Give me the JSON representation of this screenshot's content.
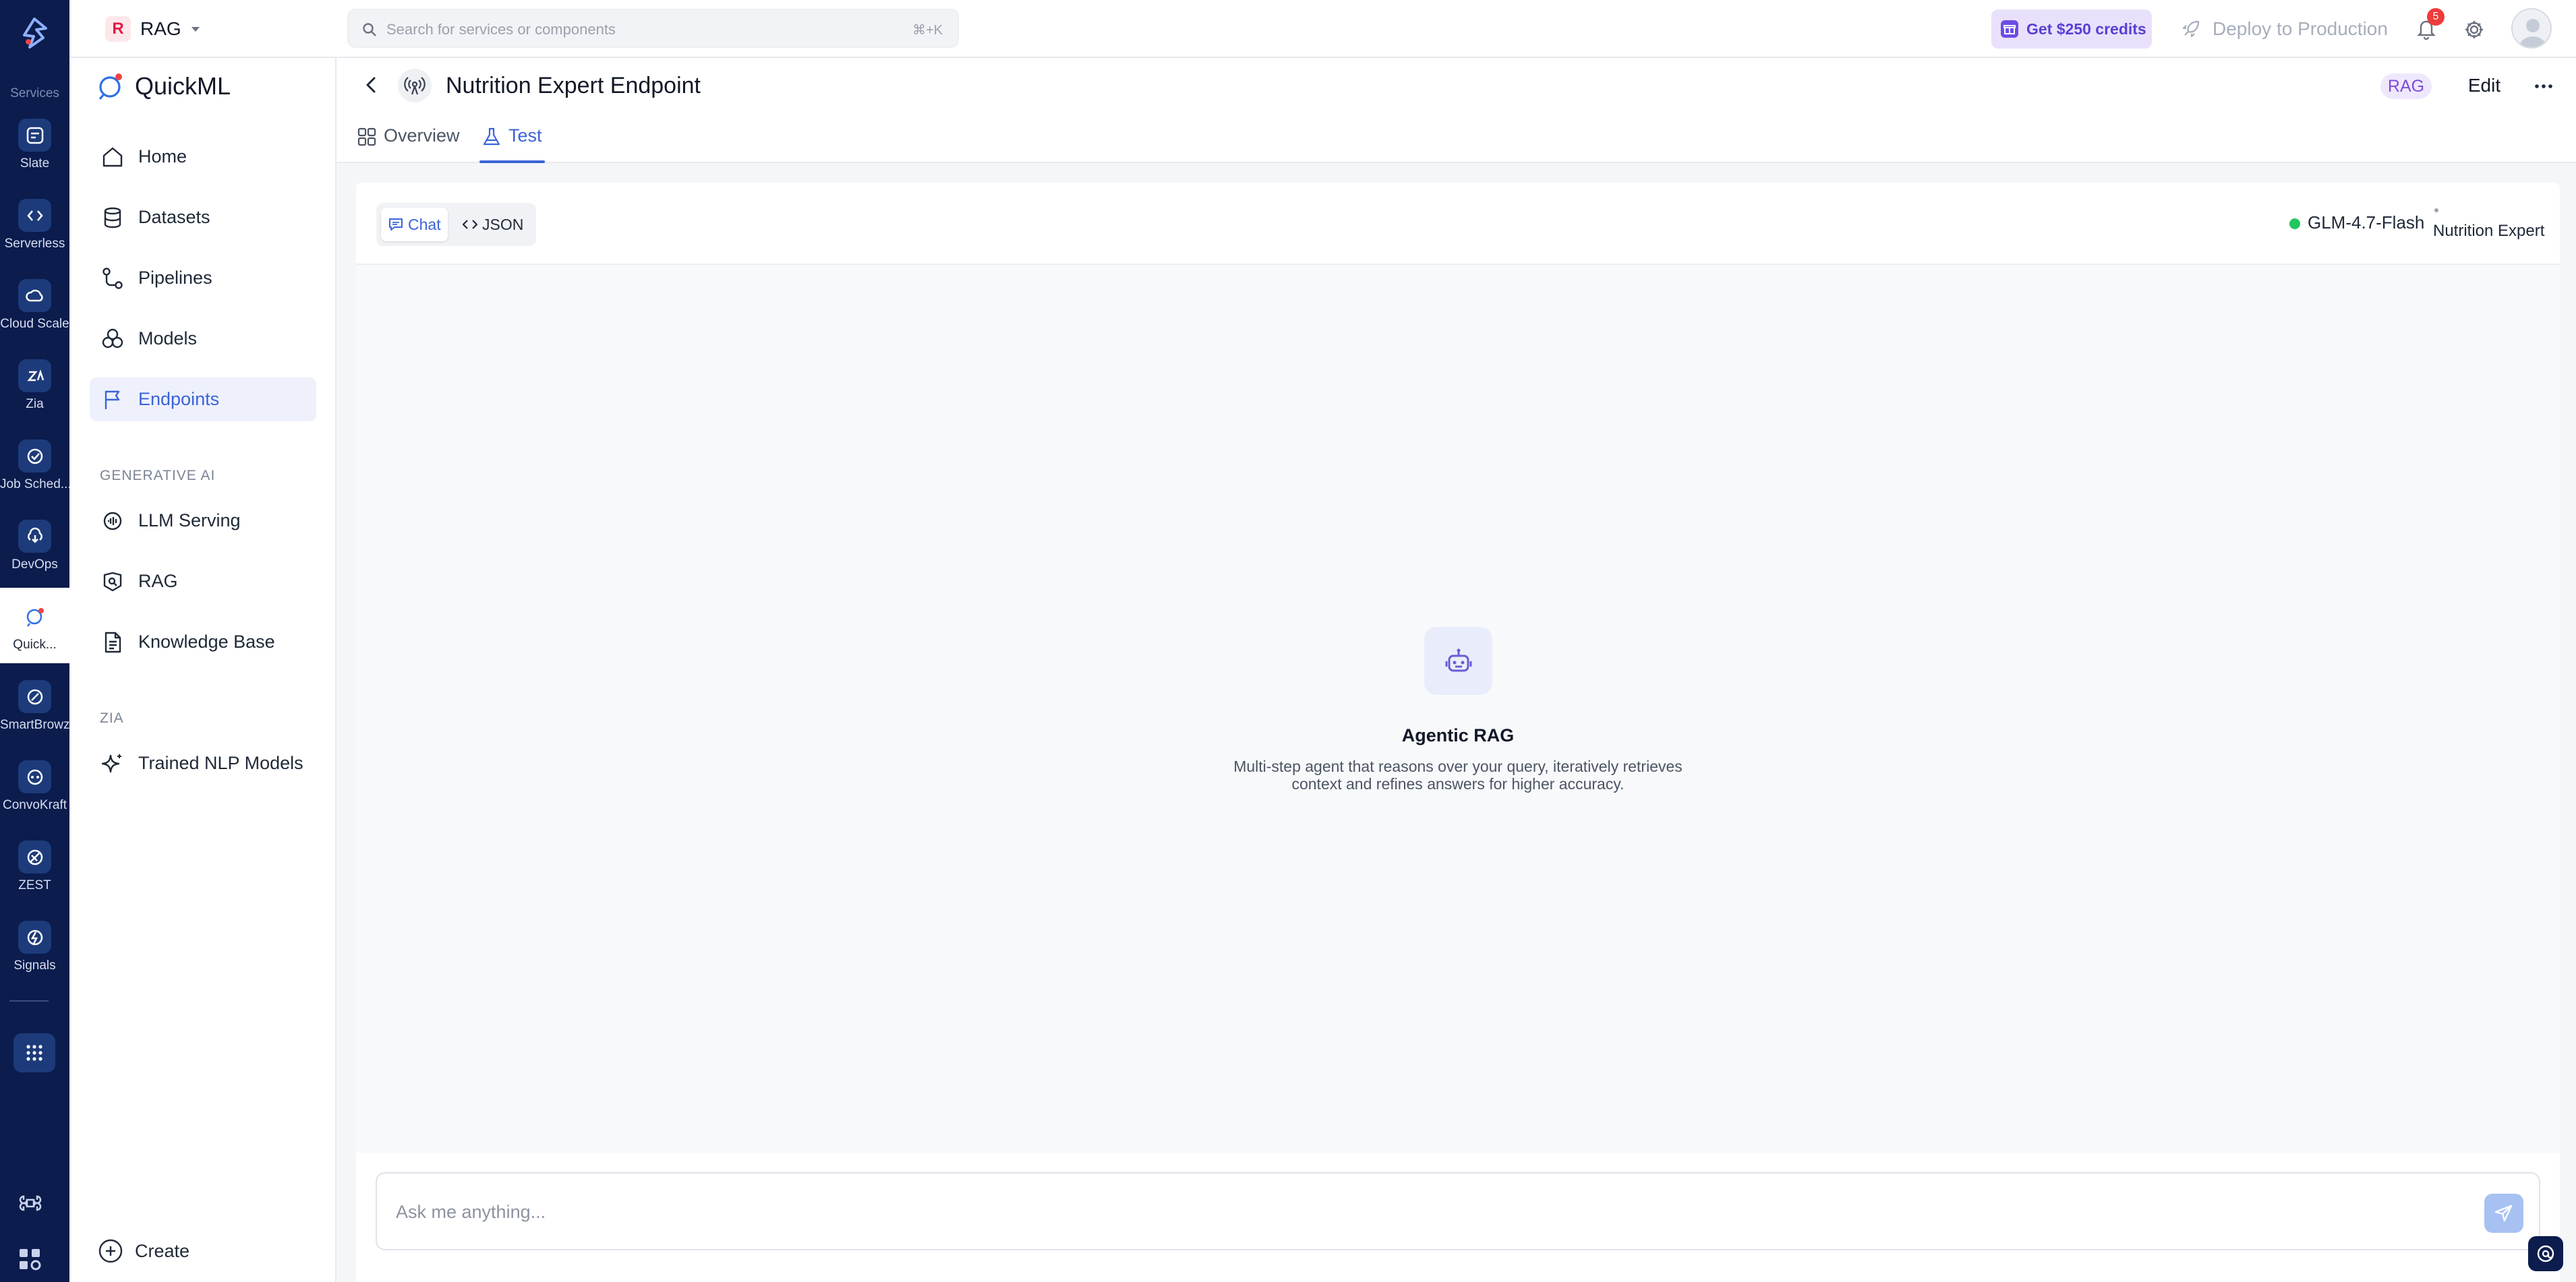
{
  "rail": {
    "section_label": "Services",
    "items": [
      {
        "label": "Slate",
        "icon": "slate-icon"
      },
      {
        "label": "Serverless",
        "icon": "serverless-icon"
      },
      {
        "label": "Cloud Scale",
        "icon": "cloud-scale-icon"
      },
      {
        "label": "Zia",
        "icon": "zia-icon"
      },
      {
        "label": "Job Sched...",
        "icon": "job-scheduling-icon"
      },
      {
        "label": "DevOps",
        "icon": "devops-icon"
      },
      {
        "label": "Quick...",
        "icon": "quickml-icon"
      },
      {
        "label": "SmartBrowz",
        "icon": "smartbrowz-icon"
      },
      {
        "label": "ConvoKraft",
        "icon": "convokraft-icon"
      },
      {
        "label": "ZEST",
        "icon": "zest-icon"
      },
      {
        "label": "Signals",
        "icon": "signals-icon"
      }
    ],
    "active_index": 6
  },
  "topbar": {
    "project_initial": "R",
    "project_name": "RAG",
    "search_placeholder": "Search for services or components",
    "search_shortcut": "⌘+K",
    "credits_label": "Get $250 credits",
    "deploy_label": "Deploy to Production",
    "notification_count": "5"
  },
  "sidebar": {
    "brand": "QuickML",
    "nav": [
      {
        "label": "Home",
        "icon": "home-icon"
      },
      {
        "label": "Datasets",
        "icon": "database-icon"
      },
      {
        "label": "Pipelines",
        "icon": "pipeline-icon"
      },
      {
        "label": "Models",
        "icon": "models-icon"
      },
      {
        "label": "Endpoints",
        "icon": "flag-icon"
      }
    ],
    "active_nav": "Endpoints",
    "section_genai": "GENERATIVE AI",
    "genai": [
      {
        "label": "LLM Serving",
        "icon": "llm-serving-icon"
      },
      {
        "label": "RAG",
        "icon": "rag-icon"
      },
      {
        "label": "Knowledge Base",
        "icon": "document-icon"
      }
    ],
    "section_zia": "ZIA",
    "zia": [
      {
        "label": "Trained NLP Models",
        "icon": "sparkle-icon"
      }
    ],
    "create_label": "Create"
  },
  "page": {
    "title": "Nutrition Expert Endpoint",
    "tag": "RAG",
    "edit_label": "Edit",
    "tabs": [
      {
        "label": "Overview",
        "icon": "grid-icon"
      },
      {
        "label": "Test",
        "icon": "flask-icon"
      }
    ],
    "active_tab": "Test"
  },
  "test": {
    "modes": [
      {
        "label": "Chat",
        "icon": "chat-icon"
      },
      {
        "label": "JSON",
        "icon": "code-icon"
      }
    ],
    "active_mode": "Chat",
    "model_name": "GLM-4.7-Flash",
    "model_status_color": "#22c55e",
    "knowledge_base": "Nutrition Expert",
    "empty_title": "Agentic RAG",
    "empty_description": "Multi-step agent that reasons over your query, iteratively retrieves context and refines answers for higher accuracy.",
    "input_placeholder": "Ask me anything..."
  },
  "colors": {
    "rail_bg": "#0b1c4d",
    "accent": "#3b63d8",
    "rag_purple": "#7c4dd6"
  }
}
